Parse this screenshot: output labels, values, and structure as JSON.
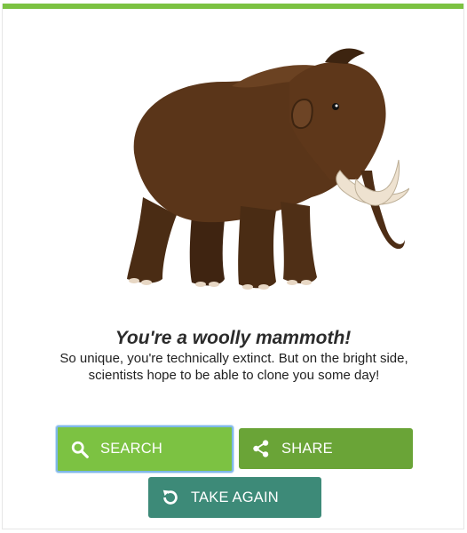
{
  "result": {
    "title": "You're a woolly mammoth!",
    "description": "So unique, you're technically extinct. But on the bright side, scientists hope to be able to clone you some day!"
  },
  "buttons": {
    "search_label": "SEARCH",
    "share_label": "SHARE",
    "take_again_label": "TAKE AGAIN"
  },
  "icons": {
    "search": "search-icon",
    "share": "share-icon",
    "take_again": "refresh-icon"
  },
  "colors": {
    "accent_green": "#7cc242",
    "share_green": "#6aa437",
    "take_again_teal": "#3d8a78",
    "focus_ring": "#7fb8e8"
  }
}
